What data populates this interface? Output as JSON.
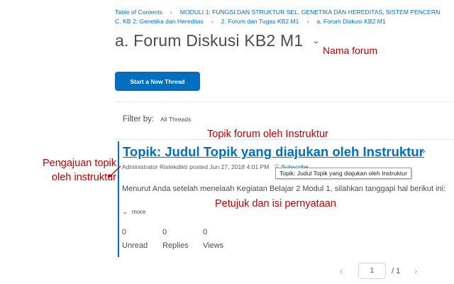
{
  "breadcrumb": {
    "row1": [
      "Table of Contents",
      "MODULI 1: FUNGSI DAN STRUKTUR SEL, GENETIKA DAN HEREDITAS, SISTEM PENCERN"
    ],
    "row2": [
      "C. KB 2: Genetika dan Hereditas",
      "2. Forum dan Tugas KB2 M1",
      "a. Forum Diskusi KB2 M1"
    ]
  },
  "page": {
    "title": "a. Forum Diskusi KB2 M1",
    "start_button": "Start a New Thread",
    "filter_label": "Filter by:",
    "filter_value": "All Threads"
  },
  "thread": {
    "title": "Topik: Judul Topik yang diajukan oleh Instruktur",
    "author": "Administrator Ristekdikti",
    "posted": "posted Jun 27, 2018 4:01 PM",
    "subscribe": "Subscribe",
    "tooltip": "Topik: Judul Topik yang diajukan oleh Instruktur",
    "body": "Menurut Anda setelah menelaah Kegiatan Belajar 2 Modul 1, silahkan tanggapi hal berikut ini:",
    "more": "more",
    "stats": [
      {
        "value": "0",
        "label": "Unread"
      },
      {
        "value": "0",
        "label": "Replies"
      },
      {
        "value": "0",
        "label": "Views"
      }
    ]
  },
  "pager": {
    "current": "1",
    "total": "/ 1"
  },
  "annotations": {
    "nama_forum": "Nama forum",
    "topik_forum": "Topik forum oleh Instruktur",
    "pengajuan_line1": "Pengajuan topik",
    "pengajuan_line2": "oleh instruktur",
    "petunjuk": "Petujuk dan isi pernyataan"
  },
  "icons": {
    "title_chevron": "chevron-down-icon",
    "thread_chevron": "chevron-down-icon",
    "subscribe": "star-icon",
    "more": "chevron-down-icon",
    "pager_prev": "chevron-left-icon",
    "pager_next": "chevron-right-icon"
  },
  "colors": {
    "link_blue": "#006fbf",
    "annotation_red": "#c00000",
    "text_gray": "#494c4e"
  }
}
